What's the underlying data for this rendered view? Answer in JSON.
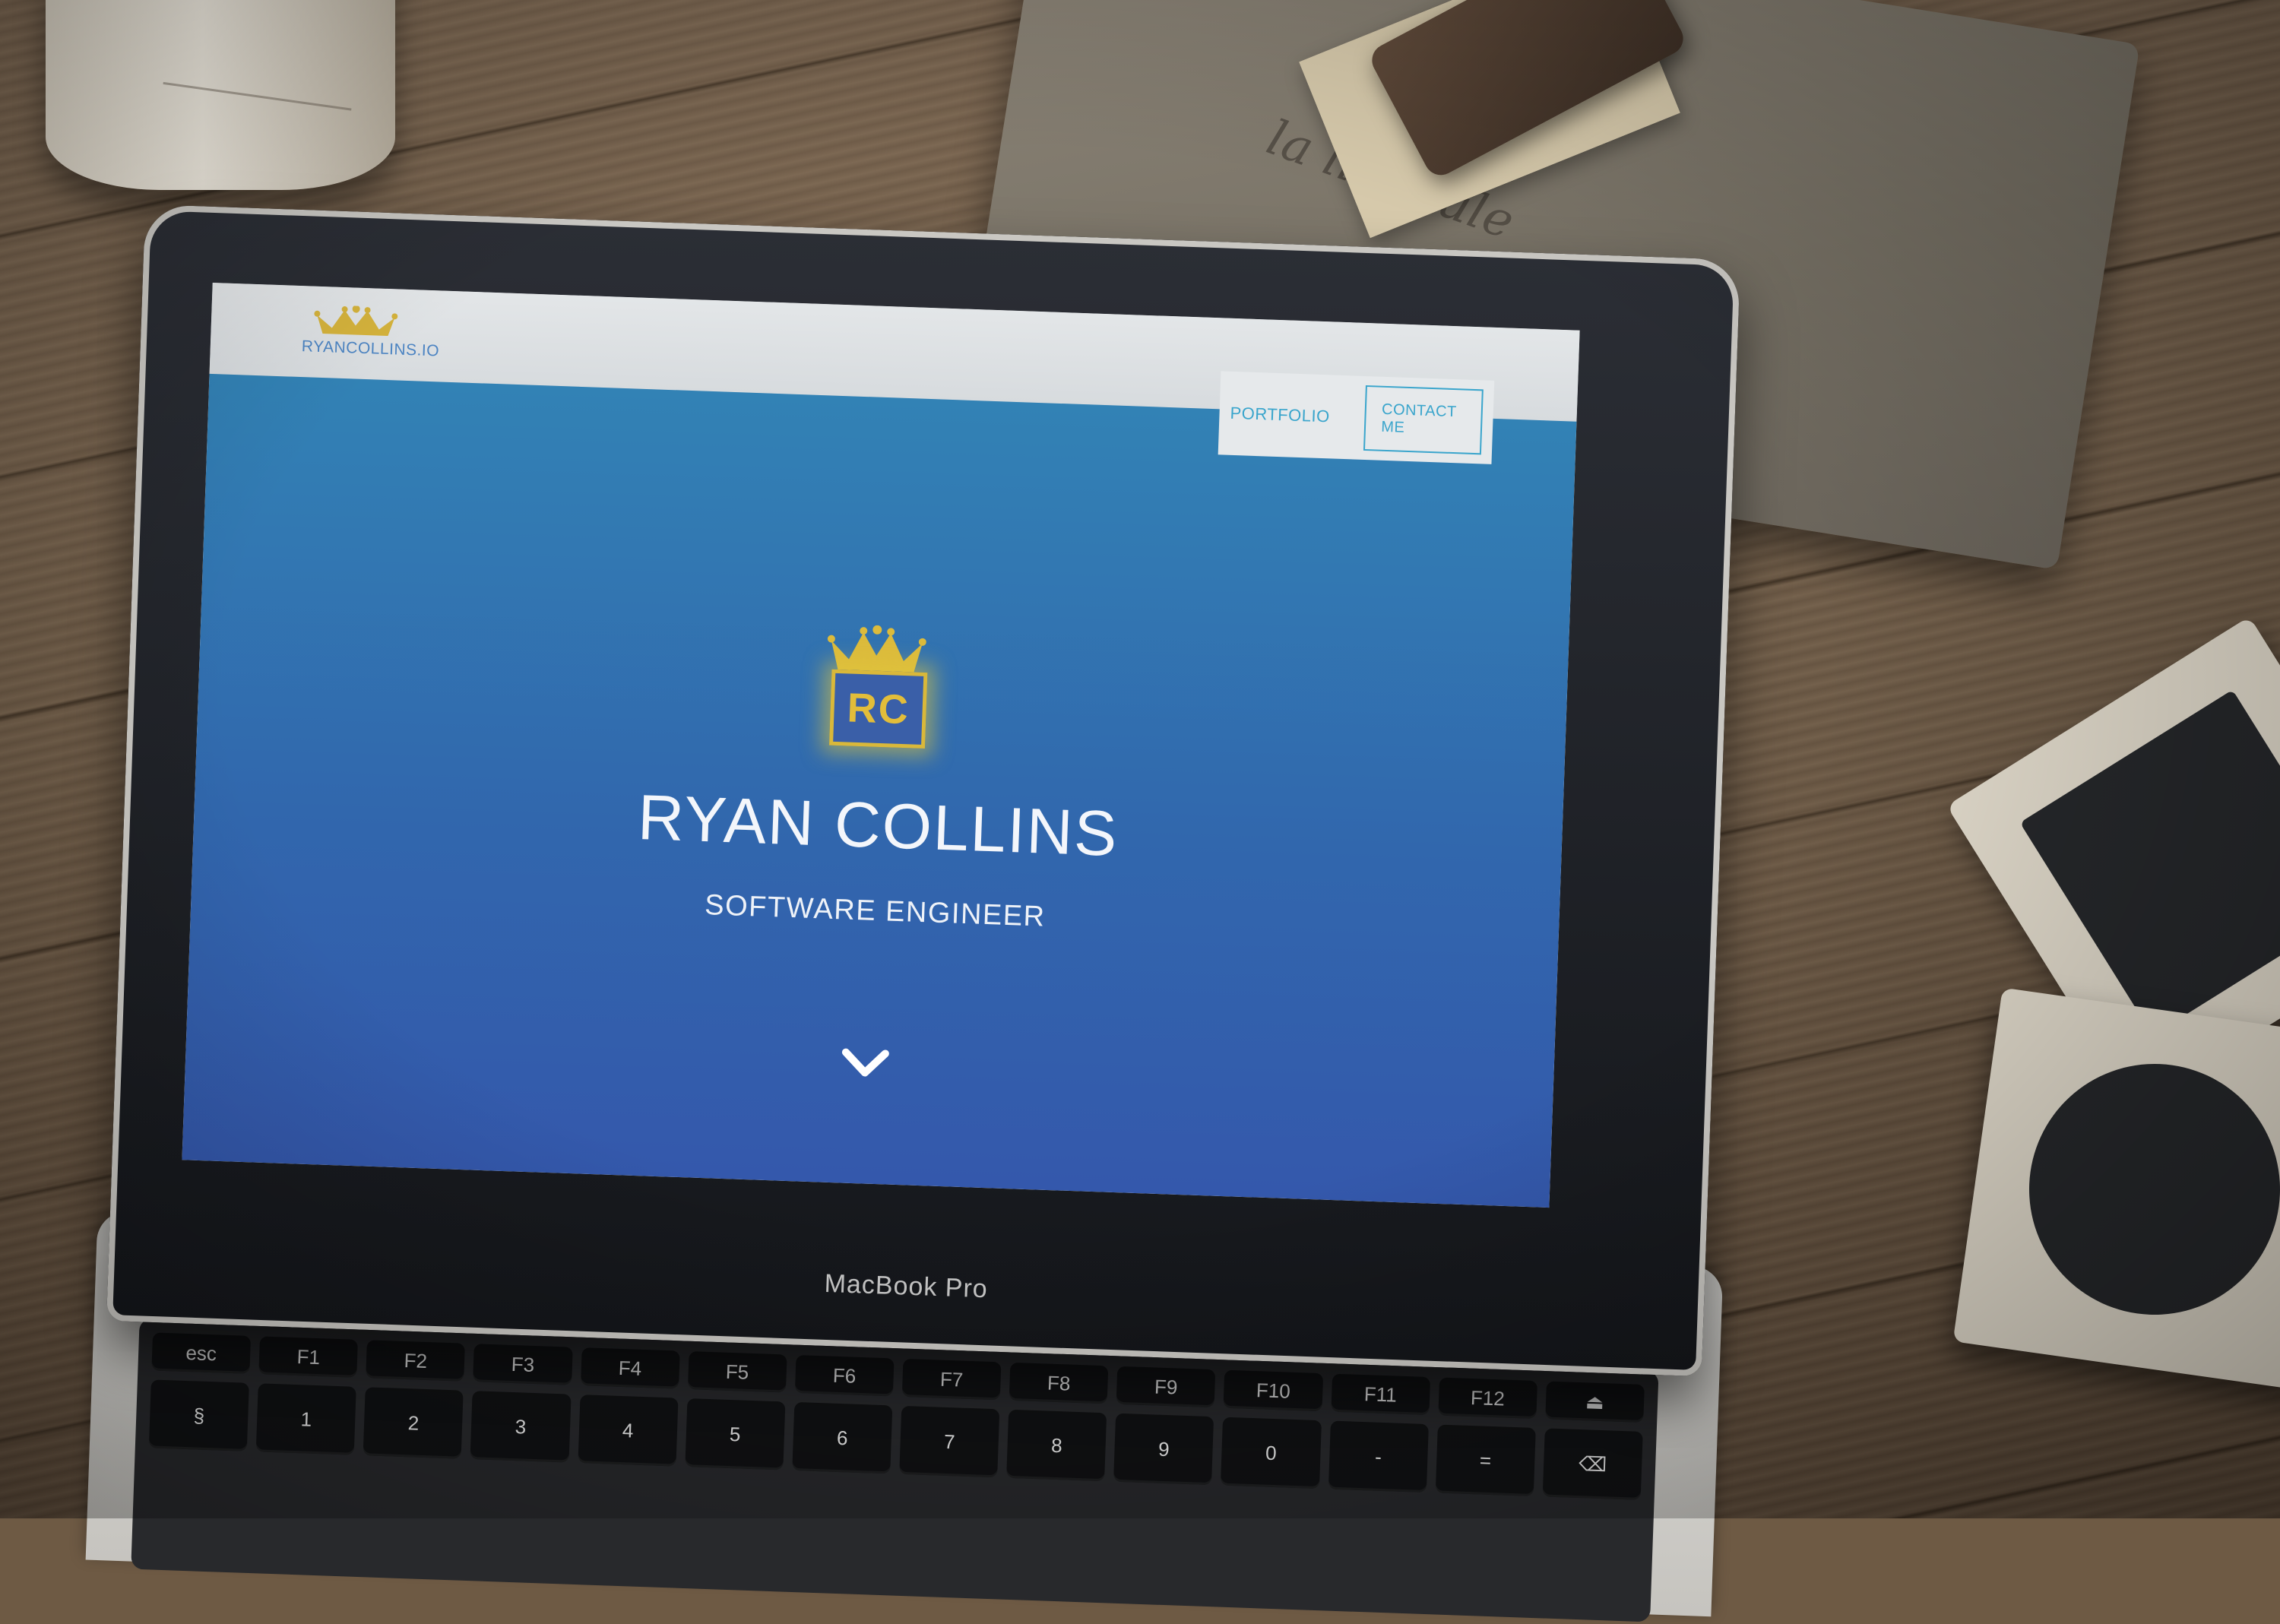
{
  "site": {
    "logo_text": "RYANCOLLINS.IO",
    "nav": {
      "portfolio_label": "PORTFOLIO",
      "contact_label": "CONTACT ME"
    },
    "hero": {
      "monogram": "RC",
      "name": "RYAN COLLINS",
      "title": "SOFTWARE ENGINEER"
    }
  },
  "device": {
    "brand": "MacBook Pro"
  },
  "keyboard": {
    "row1": [
      "esc",
      "F1",
      "F2",
      "F3",
      "F4",
      "F5",
      "F6",
      "F7",
      "F8",
      "F9",
      "F10",
      "F11",
      "F12",
      "⏏"
    ],
    "row2": [
      "§",
      "1",
      "2",
      "3",
      "4",
      "5",
      "6",
      "7",
      "8",
      "9",
      "0",
      "-",
      "=",
      "⌫"
    ]
  },
  "icons": {
    "crown": "crown-icon",
    "scroll_down": "chevron-down-icon",
    "power": "power-icon"
  },
  "colors": {
    "accent": "#3aa5cc",
    "hero_top": "#3282b5",
    "hero_bottom": "#3458ac",
    "gold": "#d9b83a"
  }
}
